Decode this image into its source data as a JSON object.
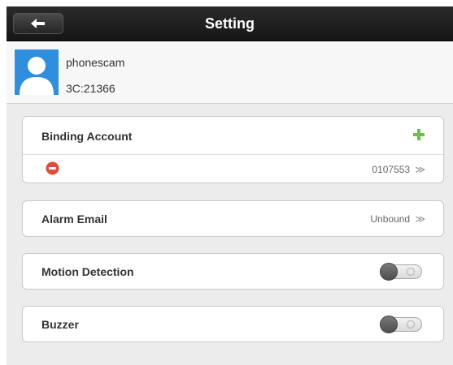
{
  "header": {
    "title": "Setting",
    "back_icon": "back-arrow-icon"
  },
  "profile": {
    "name": "phonescam",
    "device_id": "3C:21366",
    "avatar_icon": "user-avatar-icon"
  },
  "binding_account": {
    "label": "Binding Account",
    "add_icon": "plus-icon",
    "entries": [
      {
        "remove_icon": "remove-circle-icon",
        "value": "0107553",
        "chevron": "≫"
      }
    ]
  },
  "alarm_email": {
    "label": "Alarm Email",
    "value": "Unbound",
    "chevron": "≫"
  },
  "motion_detection": {
    "label": "Motion Detection",
    "enabled": false
  },
  "buzzer": {
    "label": "Buzzer",
    "enabled": false
  },
  "colors": {
    "titlebar": "#1e1e1e",
    "background": "#ececec",
    "avatar": "#2f8fdc",
    "add_green": "#6cc04a",
    "remove_red": "#e04b3a"
  }
}
